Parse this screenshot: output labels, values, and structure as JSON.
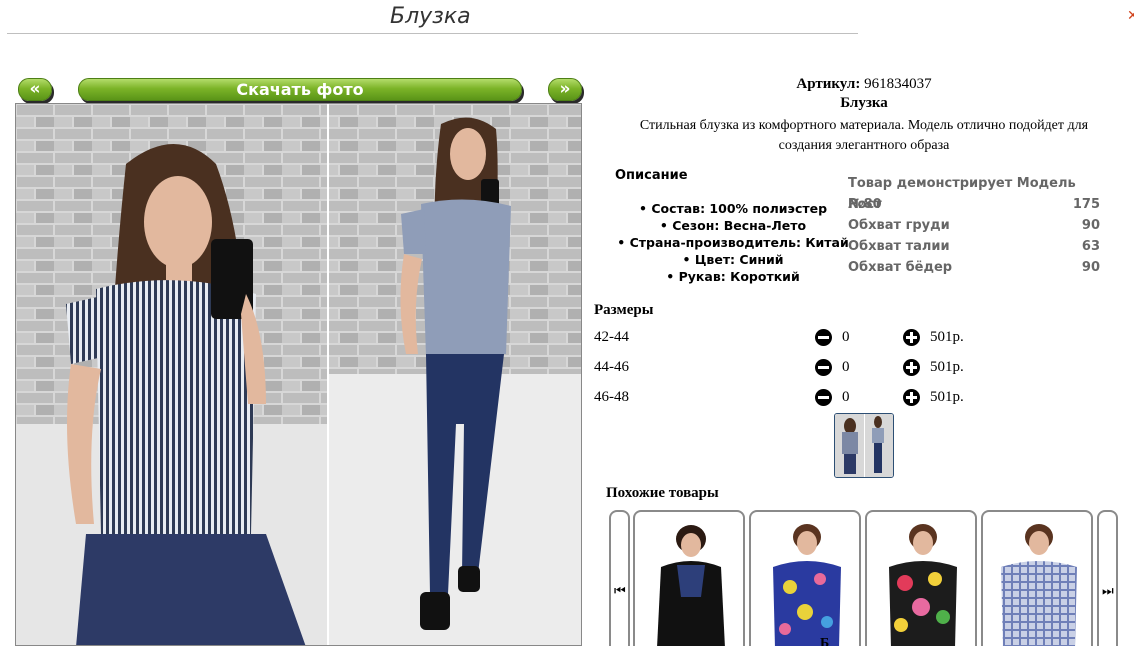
{
  "header": {
    "title": "Блузка"
  },
  "gallery": {
    "prev_label": "«",
    "download_label": "Скачать фото",
    "next_label": "»"
  },
  "product": {
    "article_label": "Артикул:",
    "article_value": "961834037",
    "name": "Блузка",
    "description_line1": "Стильная блузка из комфортного материала. Модель отлично подойдет для",
    "description_line2": "создания элегантного образа"
  },
  "description": {
    "heading": "Описание",
    "items": [
      "Состав: 100% полиэстер",
      "Сезон: Весна-Лето",
      "Страна-производитель: Китай",
      "Цвет: Синий",
      "Рукав: Короткий"
    ]
  },
  "model": {
    "heading": "Товар демонстрирует Модель №80",
    "rows": [
      {
        "label": "Рост",
        "value": "175"
      },
      {
        "label": "Обхват груди",
        "value": "90"
      },
      {
        "label": "Обхват талии",
        "value": "63"
      },
      {
        "label": "Обхват бёдер",
        "value": "90"
      }
    ]
  },
  "sizes": {
    "heading": "Размеры",
    "rows": [
      {
        "size": "42-44",
        "qty": "0",
        "price": "501р."
      },
      {
        "size": "44-46",
        "qty": "0",
        "price": "501р."
      },
      {
        "size": "46-48",
        "qty": "0",
        "price": "501р."
      }
    ]
  },
  "similar": {
    "heading": "Похожие товары",
    "cut_off_caption": "Б"
  },
  "icons": {
    "minus": "minus-circle-icon",
    "plus": "plus-circle-icon",
    "prev": "skip-back-icon",
    "next": "skip-forward-icon"
  },
  "colors": {
    "button_green": "#7cb428",
    "thumb_border": "#2d4f74",
    "accent_orange": "#d0421b"
  }
}
